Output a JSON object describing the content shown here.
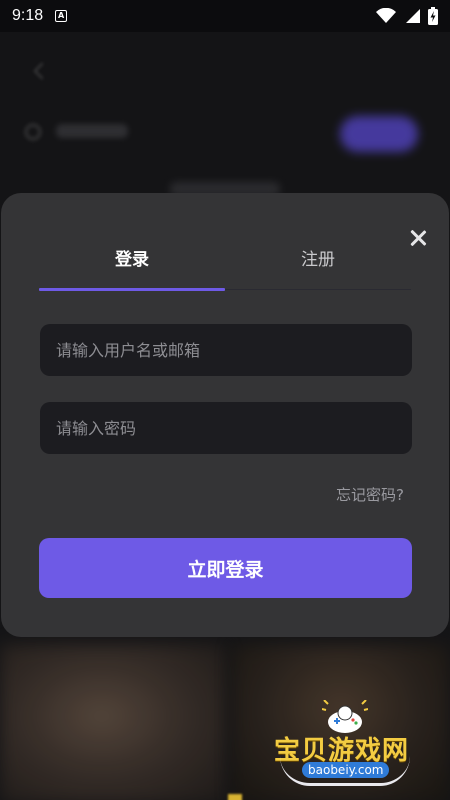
{
  "status_bar": {
    "time": "9:18",
    "notification_icon": "a-badge-icon",
    "icons": [
      "wifi-icon",
      "signal-icon",
      "battery-icon"
    ]
  },
  "login_modal": {
    "tabs": [
      {
        "label": "登录",
        "active": true
      },
      {
        "label": "注册",
        "active": false
      }
    ],
    "username_placeholder": "请输入用户名或邮箱",
    "username_value": "",
    "password_placeholder": "请输入密码",
    "password_value": "",
    "forgot_password_label": "忘记密码?",
    "submit_label": "立即登录",
    "close_icon": "close-icon"
  },
  "watermark": {
    "name": "宝贝游戏网",
    "url": "baobeiy.com"
  },
  "colors": {
    "accent": "#6e5ae6",
    "modal_bg": "#343436",
    "input_bg": "#1c1c20",
    "watermark_yellow": "#f3cc42"
  }
}
